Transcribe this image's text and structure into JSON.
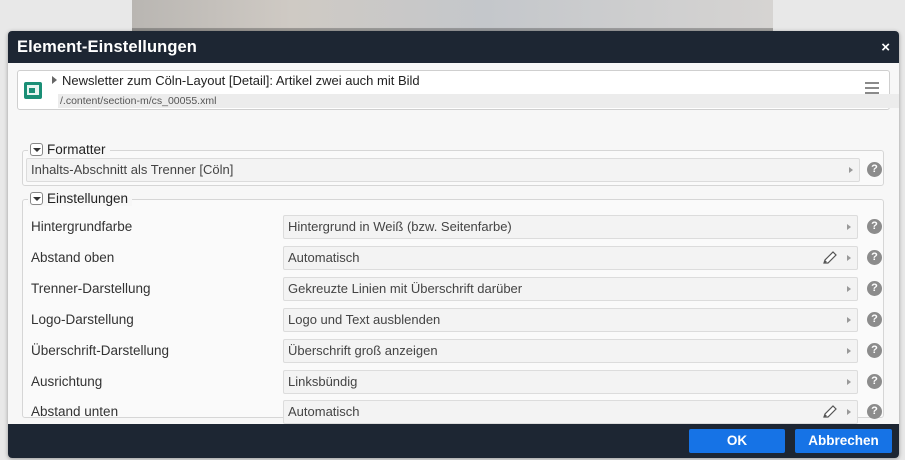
{
  "dialog": {
    "title": "Element-Einstellungen",
    "close_glyph": "×"
  },
  "resource": {
    "title": "Newsletter zum Cöln-Layout [Detail]: Artikel zwei auch mit Bild",
    "path": "/.content/section-m/cs_00055.xml",
    "icon": "content-document-icon"
  },
  "formatter": {
    "legend": "Formatter",
    "value": "Inhalts-Abschnitt als Trenner [Cöln]"
  },
  "settings": {
    "legend": "Einstellungen",
    "rows": [
      {
        "label": "Hintergrundfarbe",
        "value": "Hintergrund in Weiß (bzw. Seitenfarbe)",
        "editable": false
      },
      {
        "label": "Abstand oben",
        "value": "Automatisch",
        "editable": true
      },
      {
        "label": "Trenner-Darstellung",
        "value": "Gekreuzte Linien mit Überschrift darüber",
        "editable": false
      },
      {
        "label": "Logo-Darstellung",
        "value": "Logo und Text ausblenden",
        "editable": false
      },
      {
        "label": "Überschrift-Darstellung",
        "value": "Überschrift groß anzeigen",
        "editable": false
      },
      {
        "label": "Ausrichtung",
        "value": "Linksbündig",
        "editable": false
      },
      {
        "label": "Abstand unten",
        "value": "Automatisch",
        "editable": true
      }
    ]
  },
  "buttons": {
    "ok": "OK",
    "cancel": "Abbrechen"
  },
  "help_glyph": "?",
  "colors": {
    "titlebar": "#1d2633",
    "button": "#1673e6",
    "icon": "#1a8f76"
  }
}
